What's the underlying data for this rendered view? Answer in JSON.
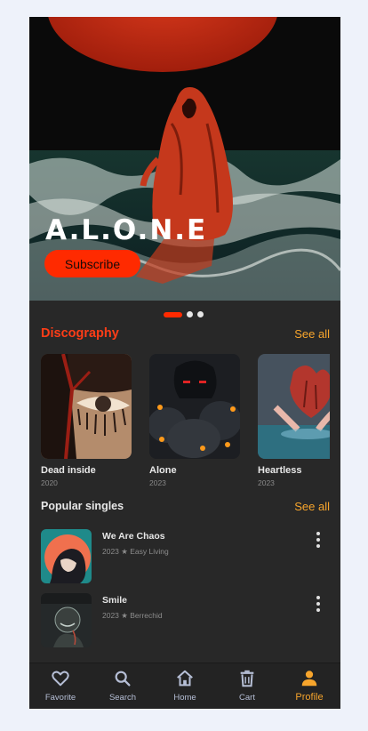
{
  "hero": {
    "title": "A.L.O.N.E",
    "subscribe_label": "Subscribe",
    "carousel_active_index": 0,
    "carousel_count": 3
  },
  "discography": {
    "title": "Discography",
    "see_all": "See all",
    "albums": [
      {
        "name": "Dead inside",
        "year": "2020"
      },
      {
        "name": "Alone",
        "year": "2023"
      },
      {
        "name": "Heartless",
        "year": "2023"
      }
    ]
  },
  "popular_singles": {
    "title": "Popular singles",
    "see_all": "See all",
    "items": [
      {
        "title": "We Are Chaos",
        "meta": "2023 ★ Easy Living"
      },
      {
        "title": "Smile",
        "meta": "2023  ★  Berrechid"
      }
    ]
  },
  "bottom_nav": {
    "items": [
      {
        "label": "Favorite",
        "icon": "heart-icon"
      },
      {
        "label": "Search",
        "icon": "search-icon"
      },
      {
        "label": "Home",
        "icon": "home-icon"
      },
      {
        "label": "Cart",
        "icon": "trash-icon"
      },
      {
        "label": "Profile",
        "icon": "user-icon",
        "active": true
      }
    ]
  },
  "colors": {
    "accent_red": "#ff2a00",
    "accent_orange": "#f7a52c",
    "background": "#282828",
    "nav_inactive": "#b6bfd6"
  }
}
